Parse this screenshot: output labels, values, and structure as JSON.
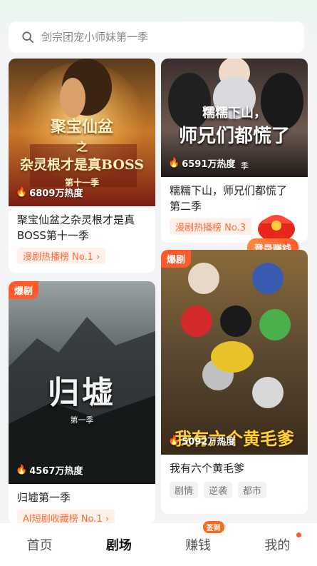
{
  "search": {
    "placeholder": "剑宗团宠小师妹第一季"
  },
  "cards": [
    {
      "poster_text_1": "聚宝仙盆",
      "poster_text_2": "之",
      "poster_text_3": "杂灵根才是真BOSS",
      "poster_text_4": "第十一季",
      "heat": "6809万热度",
      "title": "聚宝仙盆之杂灵根才是真BOSS第十一季",
      "rank": "漫剧热播榜 No.1 ›"
    },
    {
      "poster_text_1": "糯糯下山，",
      "poster_text_2": "师兄们都慌了",
      "poster_text_3": "季",
      "heat": "6591万热度",
      "title": "糯糯下山，师兄们都慌了第二季",
      "rank": "漫剧热播榜 No.3",
      "close": "×"
    },
    {
      "tag": "爆剧",
      "poster_text_1": "归墟",
      "poster_text_2": "第一季",
      "heat": "4567万热度",
      "title": "归墟第一季",
      "rank": "AI短剧收藏榜 No.1 ›"
    },
    {
      "tag": "爆剧",
      "poster_text_1": "我有六个黄毛爹",
      "heat": "5092万热度",
      "title": "我有六个黄毛爹",
      "genres": [
        "剧情",
        "逆袭",
        "都市"
      ]
    }
  ],
  "promo": {
    "login_label": "登录赚钱"
  },
  "tabbar": {
    "tabs": [
      {
        "label": "首页"
      },
      {
        "label": "剧场"
      },
      {
        "label": "赚钱",
        "badge": "签到"
      },
      {
        "label": "我的"
      }
    ]
  },
  "colors": {
    "accent": "#ff5a2c",
    "rank_bg": "#fff1ea",
    "rank_text": "#ff6a3a"
  }
}
